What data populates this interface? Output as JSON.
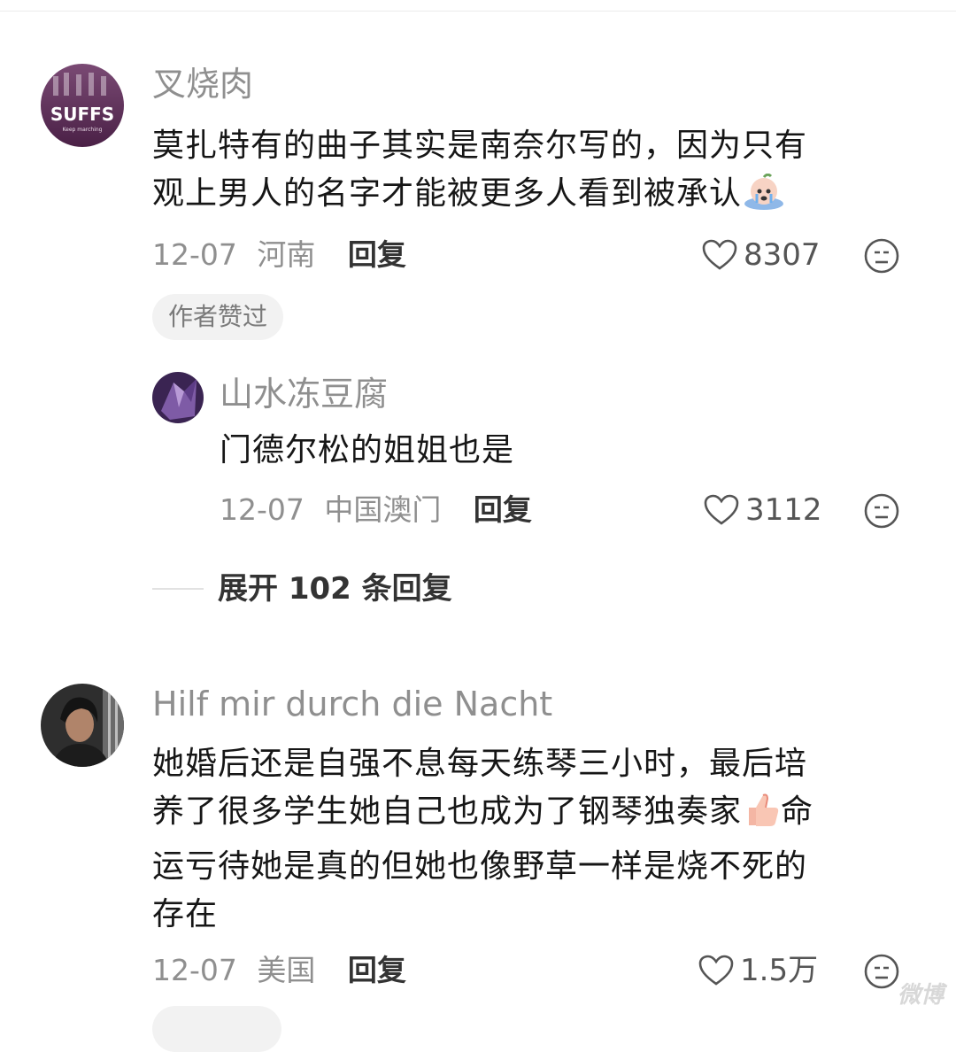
{
  "comments": [
    {
      "username": "叉烧肉",
      "avatar_text": "SUFFS",
      "avatar_subtext": "Keep marching",
      "text_line1": "莫扎特有的曲子其实是南奈尔写的，因为只有",
      "text_line2": "观上男人的名字才能被更多人看到被承认",
      "emoji": "crying-face-emoji",
      "date": "12-07",
      "location": "河南",
      "reply_label": "回复",
      "likes": "8307",
      "badge": "作者赞过",
      "replies": [
        {
          "username": "山水冻豆腐",
          "text": "门德尔松的姐姐也是",
          "date": "12-07",
          "location": "中国澳门",
          "reply_label": "回复",
          "likes": "3112"
        }
      ],
      "expand_label": "展开 102 条回复"
    },
    {
      "username": "Hilf mir durch die Nacht",
      "text_line1": "她婚后还是自强不息每天练琴三小时，最后培",
      "text_line2a": "养了很多学生她自己也成为了钢琴独奏家",
      "text_line2b": "命",
      "emoji": "thumbs-up-emoji",
      "text_line3": "运亏待她是真的但她也像野草一样是烧不死的",
      "text_line4": "存在",
      "date": "12-07",
      "location": "美国",
      "reply_label": "回复",
      "likes": "1.5万"
    }
  ],
  "watermark": "微博",
  "colors": {
    "meta_gray": "#8f8f8f",
    "badge_bg": "#f2f2f2"
  }
}
